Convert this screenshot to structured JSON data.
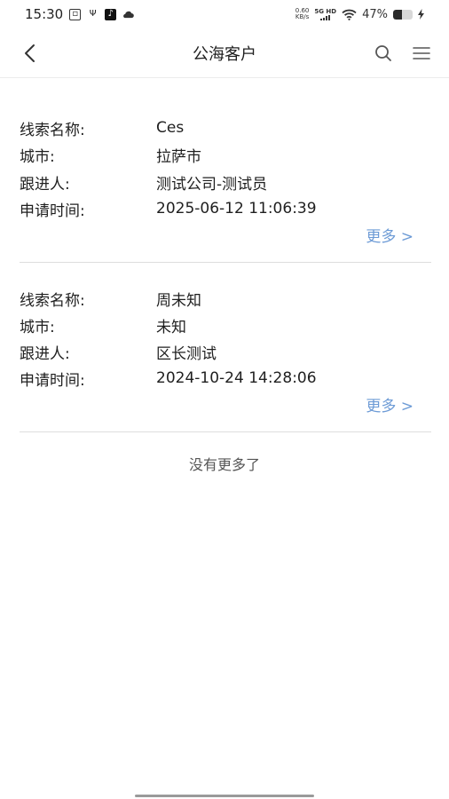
{
  "status_bar": {
    "time": "15:30",
    "speed_value": "0.60",
    "speed_unit": "KB/s",
    "network": "5G HD",
    "battery_percent": "47%",
    "battery_level": 0.47
  },
  "nav": {
    "title": "公海客户",
    "back_icon": "chevron-left-icon",
    "search_icon": "search-icon",
    "menu_icon": "menu-icon"
  },
  "cards": [
    {
      "rows": [
        {
          "label": "线索名称:",
          "value": "Ces"
        },
        {
          "label": "城市:",
          "value": "拉萨市"
        },
        {
          "label": "跟进人:",
          "value": "测试公司-测试员"
        },
        {
          "label": "申请时间:",
          "value": "2025-06-12 11:06:39"
        }
      ],
      "more_label": "更多 >"
    },
    {
      "rows": [
        {
          "label": "线索名称:",
          "value": "周未知"
        },
        {
          "label": "城市:",
          "value": "未知"
        },
        {
          "label": "跟进人:",
          "value": "区长测试"
        },
        {
          "label": "申请时间:",
          "value": "2024-10-24 14:28:06"
        }
      ],
      "more_label": "更多 >"
    }
  ],
  "footer": {
    "no_more_text": "没有更多了"
  },
  "colors": {
    "link": "#6d9bd6",
    "divider": "#dedede",
    "text": "#1f1f1f"
  }
}
